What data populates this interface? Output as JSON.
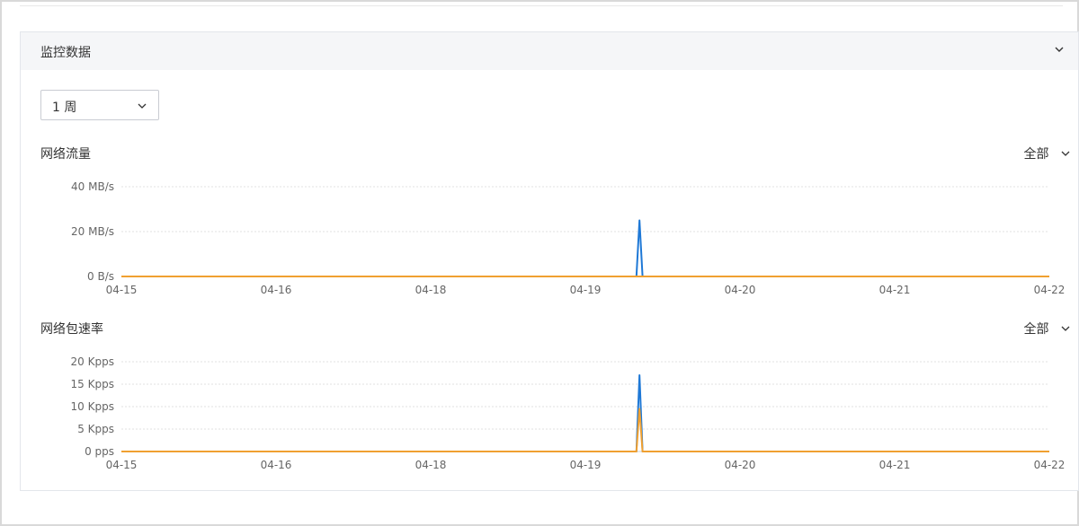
{
  "panel": {
    "title": "监控数据"
  },
  "range": {
    "value": "1 周"
  },
  "icons": {
    "collapse": "chevron-down-icon",
    "dropdown": "chevron-down-icon"
  },
  "colors": {
    "series1": "#1e78d6",
    "series2": "#f0a030",
    "grid": "#e2e2e2",
    "axis": "#666666"
  },
  "sections": [
    {
      "title": "网络流量",
      "filter_label": "全部"
    },
    {
      "title": "网络包速率",
      "filter_label": "全部"
    }
  ],
  "chart_data": [
    {
      "type": "line",
      "title": "网络流量",
      "x_ticks": [
        "04-15",
        "04-16",
        "04-18",
        "04-19",
        "04-20",
        "04-21",
        "04-22"
      ],
      "y_ticks": [
        "0 B/s",
        "20 MB/s",
        "40 MB/s"
      ],
      "ylim": [
        0,
        40
      ],
      "y_unit": "MB/s",
      "grid": true,
      "series": [
        {
          "color": "#1e78d6",
          "points": [
            [
              0,
              0
            ],
            [
              3.33,
              0
            ],
            [
              3.35,
              25
            ],
            [
              3.37,
              0
            ],
            [
              6,
              0
            ]
          ]
        },
        {
          "color": "#f0a030",
          "points": [
            [
              0,
              0
            ],
            [
              6,
              0
            ]
          ]
        }
      ]
    },
    {
      "type": "line",
      "title": "网络包速率",
      "x_ticks": [
        "04-15",
        "04-16",
        "04-18",
        "04-19",
        "04-20",
        "04-21",
        "04-22"
      ],
      "y_ticks": [
        "0 pps",
        "5 Kpps",
        "10 Kpps",
        "15 Kpps",
        "20 Kpps"
      ],
      "ylim": [
        0,
        20
      ],
      "y_unit": "Kpps",
      "grid": true,
      "series": [
        {
          "color": "#1e78d6",
          "points": [
            [
              0,
              0
            ],
            [
              3.33,
              0
            ],
            [
              3.35,
              17
            ],
            [
              3.37,
              0
            ],
            [
              6,
              0
            ]
          ]
        },
        {
          "color": "#f0a030",
          "points": [
            [
              0,
              0
            ],
            [
              3.33,
              0
            ],
            [
              3.35,
              9.5
            ],
            [
              3.37,
              0
            ],
            [
              6,
              0
            ]
          ]
        }
      ]
    }
  ]
}
